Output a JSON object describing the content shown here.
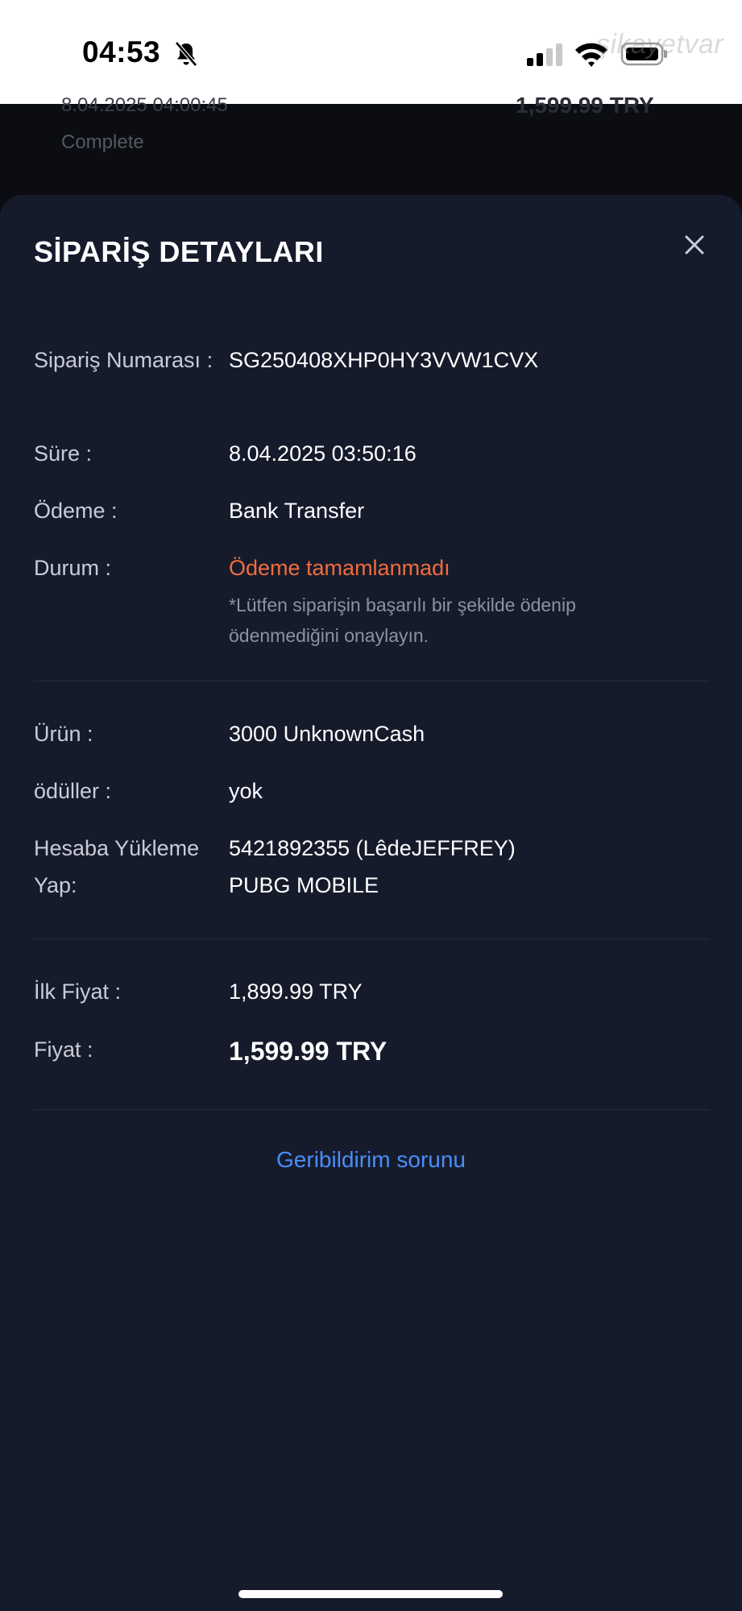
{
  "status_bar": {
    "time": "04:53",
    "watermark": "şikayetvar"
  },
  "background_order": {
    "date": "8.04.2025 04:00:45",
    "status": "Complete",
    "price": "1,599.99 TRY"
  },
  "sheet": {
    "title": "SİPARİŞ DETAYLARI",
    "order": {
      "number_label": "Sipariş Numarası :",
      "number_value": "SG250408XHP0HY3VVW1CVX",
      "time_label": "Süre :",
      "time_value": "8.04.2025 03:50:16",
      "payment_label": "Ödeme :",
      "payment_value": "Bank Transfer",
      "status_label": "Durum :",
      "status_value": "Ödeme tamamlanmadı",
      "status_note": "*Lütfen siparişin başarılı bir şekilde ödenip ödenmediğini onaylayın."
    },
    "product": {
      "product_label": "Ürün :",
      "product_value": "3000 UnknownCash",
      "rewards_label": "ödüller :",
      "rewards_value": "yok",
      "account_label": "Hesaba Yükleme Yap:",
      "account_value_line1": "5421892355 (LêdeJEFFREY)",
      "account_value_line2": "PUBG MOBILE"
    },
    "price": {
      "original_label": "İlk Fiyat :",
      "original_value": "1,899.99 TRY",
      "final_label": "Fiyat :",
      "final_value": "1,599.99 TRY"
    },
    "feedback_link": "Geribildirim sorunu"
  },
  "colors": {
    "sheet_bg": "#161b2c",
    "status_orange": "#f26c3a",
    "link_blue": "#4a8ef5"
  },
  "icons": {
    "close": "close-icon",
    "bell": "bell-slash-icon",
    "signal": "cellular-signal-icon",
    "wifi": "wifi-icon",
    "battery": "battery-icon"
  }
}
